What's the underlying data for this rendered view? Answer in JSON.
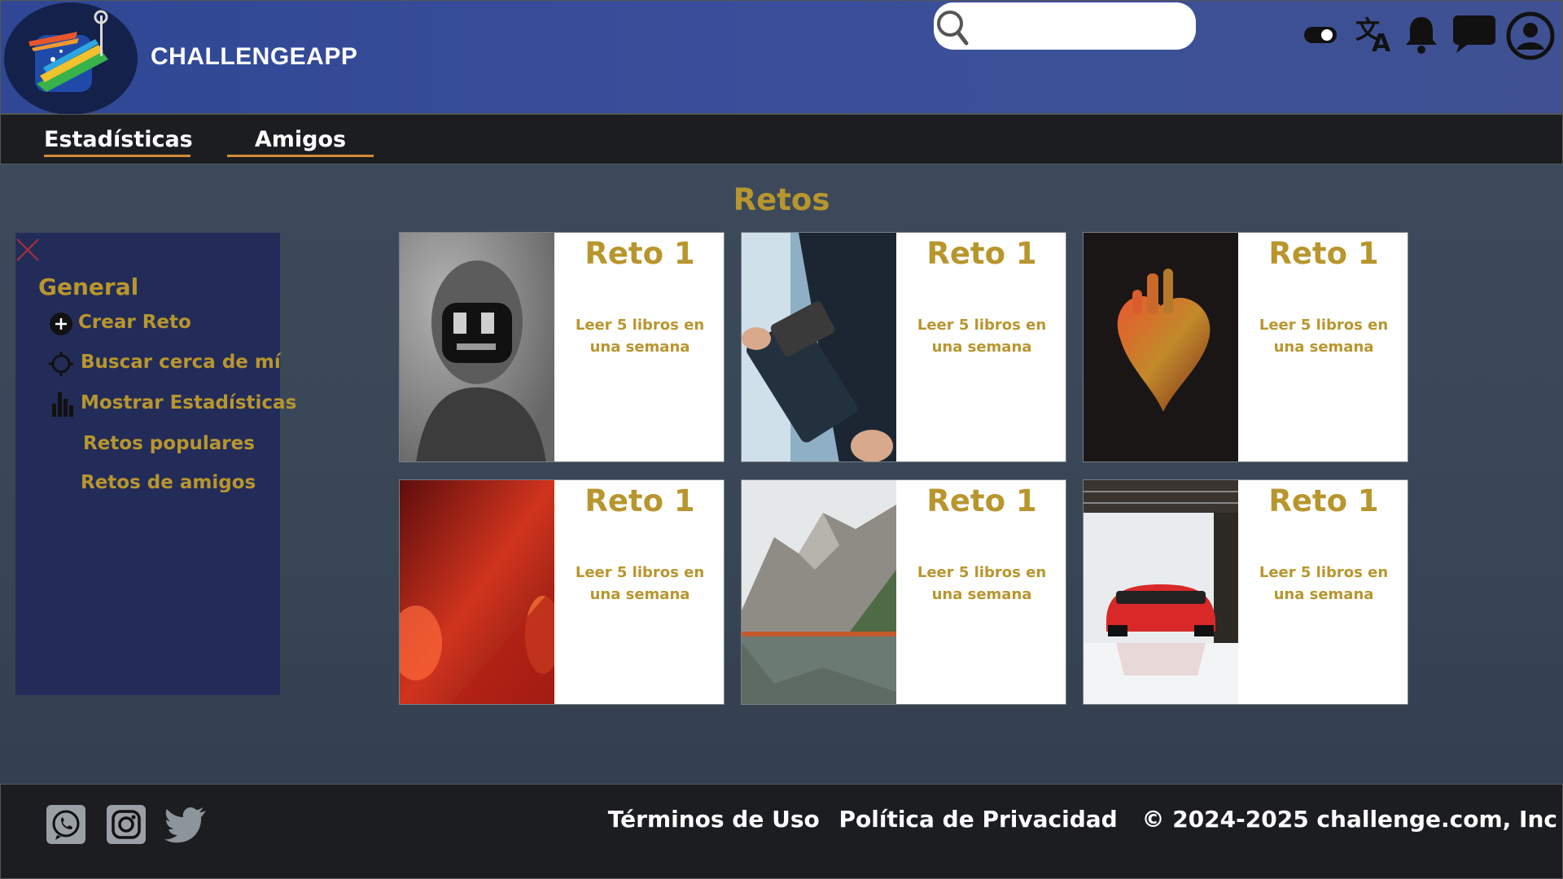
{
  "header": {
    "brand": "CHALLENGEAPP",
    "search": {
      "placeholder": "",
      "value": ""
    },
    "icons": [
      "toggle-icon",
      "translate-icon",
      "bell-icon",
      "chat-icon",
      "user-icon"
    ]
  },
  "nav": {
    "items": [
      {
        "label": "Estadísticas"
      },
      {
        "label": "Amigos"
      }
    ]
  },
  "main": {
    "title": "Retos",
    "cards": [
      {
        "title": "Reto 1",
        "description": "Leer 5 libros en una semana",
        "image": "dark-mask-head"
      },
      {
        "title": "Reto 1",
        "description": "Leer 5 libros en una semana",
        "image": "phone-gimbal"
      },
      {
        "title": "Reto 1",
        "description": "Leer 5 libros en una semana",
        "image": "glass-heart"
      },
      {
        "title": "Reto 1",
        "description": "Leer 5 libros en una semana",
        "image": "red-abstract"
      },
      {
        "title": "Reto 1",
        "description": "Leer 5 libros en una semana",
        "image": "mountain-lake"
      },
      {
        "title": "Reto 1",
        "description": "Leer 5 libros en una semana",
        "image": "red-sports-car"
      }
    ]
  },
  "sidebar": {
    "heading": "General",
    "items": [
      {
        "label": "Crear Reto",
        "icon": "plus-circle-icon"
      },
      {
        "label": "Buscar cerca de mí",
        "icon": "crosshair-icon"
      },
      {
        "label": "Mostrar Estadísticas",
        "icon": "bar-chart-icon"
      },
      {
        "label": "Retos populares"
      },
      {
        "label": "Retos de amigos"
      }
    ]
  },
  "footer": {
    "terms": "Términos de Uso",
    "privacy": "Política de Privacidad",
    "copyright": "© 2024-2025 challenge.com, Inc",
    "social": [
      "whatsapp-icon",
      "instagram-icon",
      "twitter-icon"
    ]
  },
  "colors": {
    "accent": "#b8962e",
    "header": "#3a4f9a",
    "nav": "#1b1d20",
    "sidebar": "#232c58",
    "underline": "#d48a3a"
  }
}
